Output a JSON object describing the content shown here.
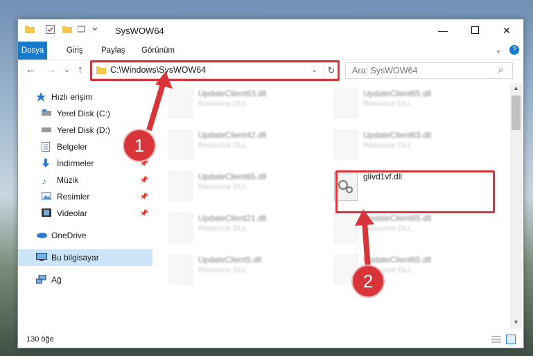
{
  "window": {
    "title": "SysWOW64",
    "controls": [
      "minimize-icon",
      "maximize-icon",
      "close-icon"
    ]
  },
  "ribbon": {
    "tabs": [
      "Dosya",
      "Giriş",
      "Paylaş",
      "Görünüm"
    ]
  },
  "address": {
    "path": "C:\\Windows\\SysWOW64",
    "search_placeholder": "Ara: SysWOW64"
  },
  "sidebar": {
    "items": [
      {
        "label": "Hızlı erişim",
        "icon": "star-icon"
      },
      {
        "label": "Yerel Disk (C:)",
        "icon": "drive-icon"
      },
      {
        "label": "Yerel Disk (D:)",
        "icon": "drive-icon"
      },
      {
        "label": "Belgeler",
        "icon": "documents-icon"
      },
      {
        "label": "İndirmeler",
        "icon": "download-icon"
      },
      {
        "label": "Müzik",
        "icon": "music-icon"
      },
      {
        "label": "Resimler",
        "icon": "pictures-icon"
      },
      {
        "label": "Videolar",
        "icon": "videos-icon"
      },
      {
        "label": "OneDrive",
        "icon": "cloud-icon"
      },
      {
        "label": "Bu bilgisayar",
        "icon": "computer-icon"
      },
      {
        "label": "Ağ",
        "icon": "network-icon"
      }
    ]
  },
  "files": [
    {
      "name": "UpdateClient63.dll",
      "desc": "Resource DLL"
    },
    {
      "name": "UpdateClient65.dll",
      "desc": "Resource DLL"
    },
    {
      "name": "UpdateClient42.dll",
      "desc": "Resource DLL"
    },
    {
      "name": "UpdateClient63.dll",
      "desc": "Resource DLL"
    },
    {
      "name": "UpdateClient65.dll",
      "desc": "Resource DLL"
    },
    {
      "name": "glivd1vf.dll",
      "desc": ""
    },
    {
      "name": "UpdateClient21.dll",
      "desc": "Resource DLL"
    },
    {
      "name": "UpdateClient65.dll",
      "desc": "Resource DLL"
    },
    {
      "name": "UpdateClient5.dll",
      "desc": "Resource DLL"
    },
    {
      "name": "UpdateClient65.dll",
      "desc": "Resource DLL"
    }
  ],
  "status": {
    "count": "130 öğe"
  },
  "annotations": {
    "badge1": "1",
    "badge2": "2"
  },
  "colors": {
    "accent": "#1979ca",
    "highlight": "#d9343a",
    "selection": "#cce4f7"
  }
}
